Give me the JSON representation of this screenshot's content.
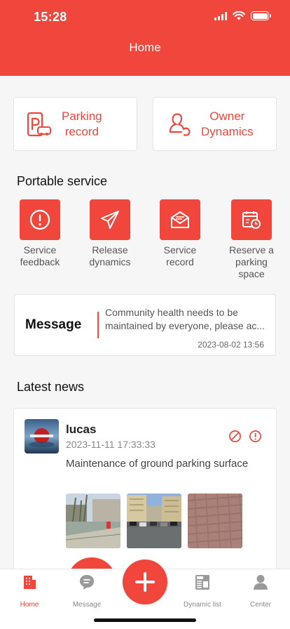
{
  "status_bar": {
    "time": "15:28"
  },
  "header": {
    "title": "Home"
  },
  "quick_actions": [
    {
      "label": "Parking\nrecord",
      "icon": "parking-record-icon"
    },
    {
      "label": "Owner\nDynamics",
      "icon": "owner-dynamics-icon"
    }
  ],
  "portable_service": {
    "title": "Portable service",
    "items": [
      {
        "label": "Service\nfeedback",
        "icon": "exclamation-circle-icon"
      },
      {
        "label": "Release\ndynamics",
        "icon": "paper-plane-icon"
      },
      {
        "label": "Service\nrecord",
        "icon": "envelope-icon"
      },
      {
        "label": "Reserve a\nparking\nspace",
        "icon": "calendar-clock-icon"
      }
    ]
  },
  "message": {
    "title": "Message",
    "text_line1": "Community health needs to be",
    "text_line2": "maintained by everyone, please ac...",
    "date": "2023-08-02 13:56"
  },
  "latest_news": {
    "title": "Latest news",
    "post": {
      "author": "lucas",
      "time": "2023-11-11 17:33:33",
      "body": "Maintenance of ground parking surface"
    }
  },
  "tabbar": {
    "tabs": [
      {
        "label": "Home",
        "icon": "building-icon",
        "active": true
      },
      {
        "label": "Message",
        "icon": "chat-bubble-icon",
        "active": false
      },
      {
        "label": "Dynamic list",
        "icon": "newspaper-icon",
        "active": false
      },
      {
        "label": "Center",
        "icon": "person-icon",
        "active": false
      }
    ],
    "fab_icon": "plus-icon"
  },
  "colors": {
    "accent": "#f1463c",
    "background": "#f6f6f6",
    "card": "#ffffff"
  }
}
